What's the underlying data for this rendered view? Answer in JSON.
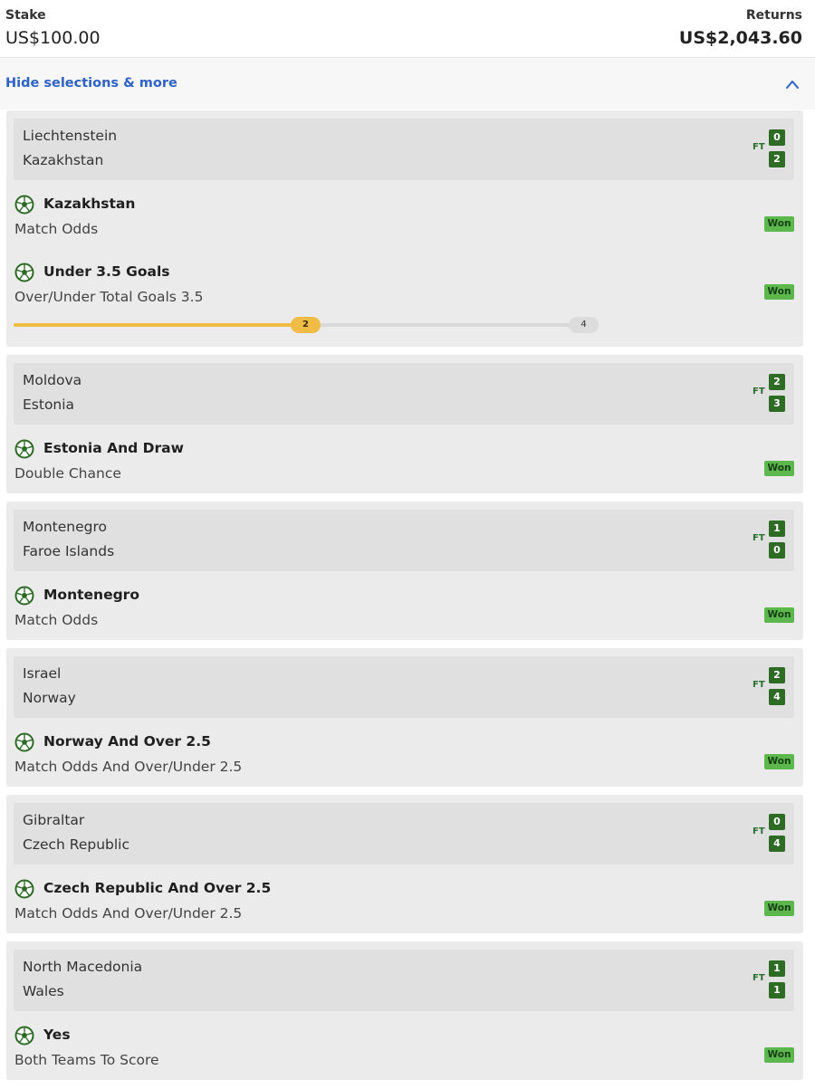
{
  "header": {
    "stake_label": "Stake",
    "stake_value": "US$100.00",
    "returns_label": "Returns",
    "returns_value": "US$2,043.60"
  },
  "toggle": {
    "label": "Hide selections & more",
    "icon": "chevron-up-icon"
  },
  "colors": {
    "accent_link": "#2f62c5",
    "score_bg": "#2e6b24",
    "won_badge": "#5cb84d",
    "progress_fill": "#f1bc45"
  },
  "cards": [
    {
      "home": "Liechtenstein",
      "away": "Kazakhstan",
      "ft": "FT",
      "home_score": "0",
      "away_score": "2",
      "selections": [
        {
          "name": "Kazakhstan",
          "market": "Match Odds",
          "status": "Won",
          "icon": "football-icon"
        },
        {
          "name": "Under 3.5 Goals",
          "market": "Over/Under Total Goals 3.5",
          "status": "Won",
          "icon": "football-icon"
        }
      ],
      "tracker": {
        "current": "2",
        "target": "4",
        "progress": 0.5
      }
    },
    {
      "home": "Moldova",
      "away": "Estonia",
      "ft": "FT",
      "home_score": "2",
      "away_score": "3",
      "selections": [
        {
          "name": "Estonia And Draw",
          "market": "Double Chance",
          "status": "Won",
          "icon": "football-icon"
        }
      ]
    },
    {
      "home": "Montenegro",
      "away": "Faroe Islands",
      "ft": "FT",
      "home_score": "1",
      "away_score": "0",
      "selections": [
        {
          "name": "Montenegro",
          "market": "Match Odds",
          "status": "Won",
          "icon": "football-icon"
        }
      ]
    },
    {
      "home": "Israel",
      "away": "Norway",
      "ft": "FT",
      "home_score": "2",
      "away_score": "4",
      "selections": [
        {
          "name": "Norway And Over 2.5",
          "market": "Match Odds And Over/Under 2.5",
          "status": "Won",
          "icon": "football-icon"
        }
      ]
    },
    {
      "home": "Gibraltar",
      "away": "Czech Republic",
      "ft": "FT",
      "home_score": "0",
      "away_score": "4",
      "selections": [
        {
          "name": "Czech Republic And Over 2.5",
          "market": "Match Odds And Over/Under 2.5",
          "status": "Won",
          "icon": "football-icon"
        }
      ]
    },
    {
      "home": "North Macedonia",
      "away": "Wales",
      "ft": "FT",
      "home_score": "1",
      "away_score": "1",
      "selections": [
        {
          "name": "Yes",
          "market": "Both Teams To Score",
          "status": "Won",
          "icon": "football-icon"
        }
      ]
    }
  ]
}
